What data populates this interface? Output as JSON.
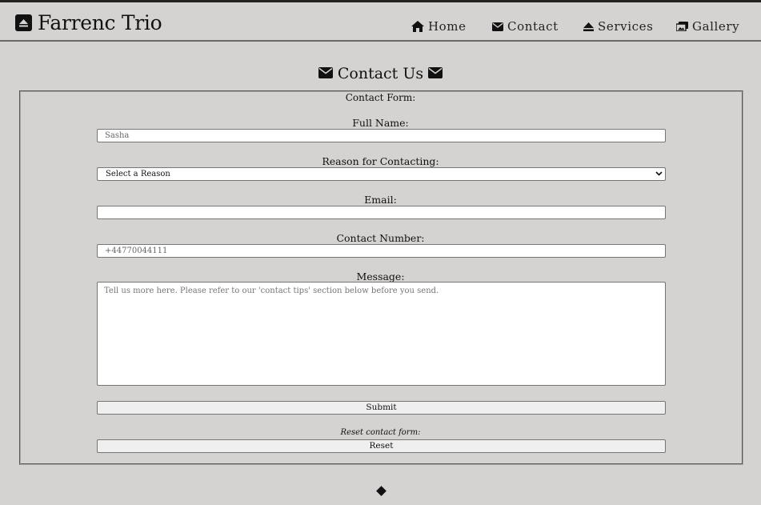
{
  "brand": {
    "name": "Farrenc Trio",
    "icon": "eject-box-icon"
  },
  "nav": {
    "items": [
      {
        "label": "Home",
        "icon": "home-icon"
      },
      {
        "label": "Contact",
        "icon": "envelope-icon"
      },
      {
        "label": "Services",
        "icon": "eject-icon"
      },
      {
        "label": "Gallery",
        "icon": "images-icon"
      }
    ]
  },
  "page": {
    "heading": "Contact Us"
  },
  "form": {
    "legend": "Contact Form:",
    "full_name": {
      "label": "Full Name:",
      "placeholder": "Sasha"
    },
    "reason": {
      "label": "Reason for Contacting:",
      "selected": "Select a Reason"
    },
    "email": {
      "label": "Email:",
      "placeholder": ""
    },
    "contact_number": {
      "label": "Contact Number:",
      "placeholder": "+44770044111"
    },
    "message": {
      "label": "Message:",
      "placeholder": "Tell us more here. Please refer to our 'contact tips' section below before you send."
    },
    "submit_label": "Submit",
    "reset_note": "Reset contact form:",
    "reset_label": "Reset"
  },
  "colors": {
    "background": "#d4d3d1",
    "text": "#111111",
    "field_border": "#767676"
  }
}
